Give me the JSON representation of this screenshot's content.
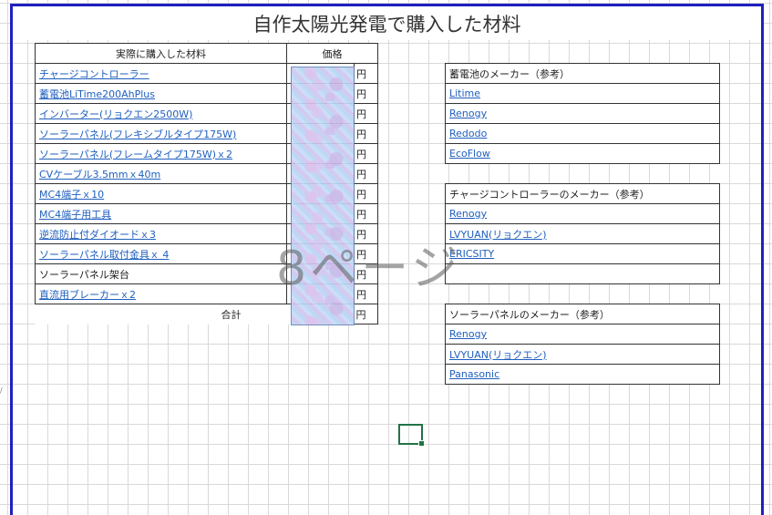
{
  "title": "自作太陽光発電で購入した材料",
  "main_table": {
    "header_name": "実際に購入した材料",
    "header_price": "価格",
    "yen": "円",
    "rows": [
      {
        "name": "チャージコントローラー",
        "link": true
      },
      {
        "name": "蓄電池LiTime200AhPlus",
        "link": true
      },
      {
        "name": "インバーター(リョクエン2500W)",
        "link": true
      },
      {
        "name": "ソーラーパネル(フレキシブルタイプ175W)",
        "link": true
      },
      {
        "name": "ソーラーパネル(フレームタイプ175W)ｘ2",
        "link": true
      },
      {
        "name": "CVケーブル3.5mmｘ40m",
        "link": true
      },
      {
        "name": "MC4端子ｘ10",
        "link": true
      },
      {
        "name": "MC4端子用工具",
        "link": true
      },
      {
        "name": "逆流防止付ダイオードｘ3",
        "link": true
      },
      {
        "name": "ソーラーパネル取付金具ｘ 4",
        "link": true
      },
      {
        "name": "ソーラーパネル架台",
        "link": false
      },
      {
        "name": "直流用ブレーカーｘ2",
        "link": true
      }
    ],
    "total_label": "合計"
  },
  "maker_battery": {
    "header": "蓄電池のメーカー（参考）",
    "items": [
      "Litime",
      "Renogy",
      "Redodo",
      "EcoFlow"
    ]
  },
  "maker_charger": {
    "header": "チャージコントローラーのメーカー（参考）",
    "items": [
      "Renogy",
      "LVYUAN(リョクエン)",
      "ERICSITY",
      ""
    ]
  },
  "maker_panel": {
    "header": "ソーラーパネルのメーカー（参考）",
    "items": [
      "Renogy",
      "LVYUAN(リョクエン)",
      "Panasonic"
    ]
  },
  "watermark": "8ページ",
  "colors": {
    "link": "#1f5fbf",
    "page_border": "#1f1fbf",
    "selection": "#217346",
    "gridline": "#d9d9d9"
  }
}
